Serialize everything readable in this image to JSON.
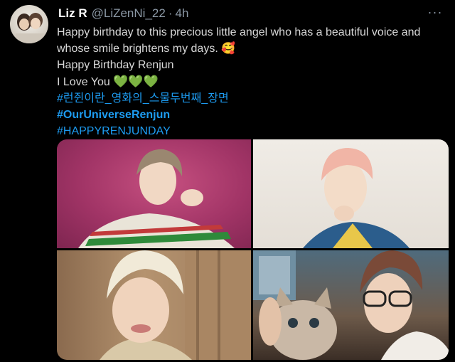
{
  "tweet": {
    "author_name": "Liz R",
    "author_handle": "@LiZenNi_22",
    "separator": "·",
    "time": "4h",
    "more_label": "···",
    "lines": [
      "Happy birthday to this precious little angel who has a beautiful voice and",
      "whose smile brightens my days. 🥰",
      "Happy Birthday Renjun",
      "I Love You"
    ],
    "hearts": "💚💚💚",
    "hashtags": [
      "#런쥔이란_영화의_스물두번째_장면",
      "#OurUniverseRenjun",
      "#HAPPYRENJUNDAY"
    ]
  },
  "colors": {
    "background": "#000000",
    "text": "#d9d9d9",
    "muted": "#8b98a5",
    "link": "#1d9bf0"
  },
  "media": {
    "photo_count": 4
  }
}
